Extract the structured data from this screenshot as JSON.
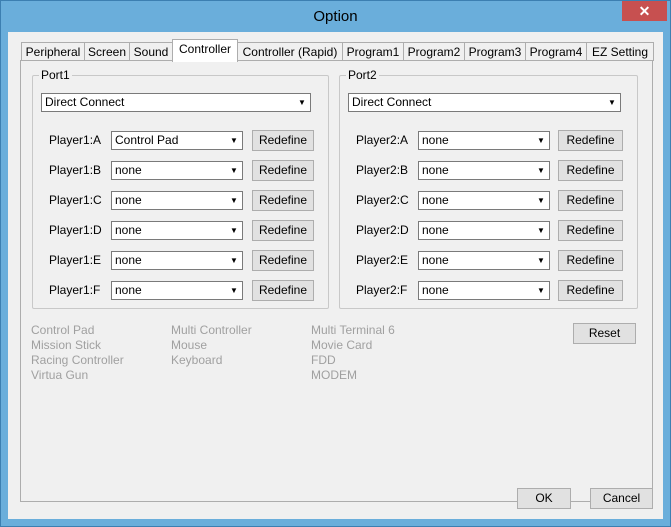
{
  "window": {
    "title": "Option",
    "close_label": "✕"
  },
  "tabs": [
    {
      "label": "Peripheral",
      "active": false
    },
    {
      "label": "Screen",
      "active": false
    },
    {
      "label": "Sound",
      "active": false
    },
    {
      "label": "Controller",
      "active": true
    },
    {
      "label": "Controller (Rapid)",
      "active": false
    },
    {
      "label": "Program1",
      "active": false
    },
    {
      "label": "Program2",
      "active": false
    },
    {
      "label": "Program3",
      "active": false
    },
    {
      "label": "Program4",
      "active": false
    },
    {
      "label": "EZ Setting",
      "active": false
    }
  ],
  "port1": {
    "label": "Port1",
    "connection": "Direct Connect",
    "players": [
      {
        "label": "Player1:A",
        "value": "Control Pad",
        "button": "Redefine"
      },
      {
        "label": "Player1:B",
        "value": "none",
        "button": "Redefine"
      },
      {
        "label": "Player1:C",
        "value": "none",
        "button": "Redefine"
      },
      {
        "label": "Player1:D",
        "value": "none",
        "button": "Redefine"
      },
      {
        "label": "Player1:E",
        "value": "none",
        "button": "Redefine"
      },
      {
        "label": "Player1:F",
        "value": "none",
        "button": "Redefine"
      }
    ]
  },
  "port2": {
    "label": "Port2",
    "connection": "Direct Connect",
    "players": [
      {
        "label": "Player2:A",
        "value": "none",
        "button": "Redefine"
      },
      {
        "label": "Player2:B",
        "value": "none",
        "button": "Redefine"
      },
      {
        "label": "Player2:C",
        "value": "none",
        "button": "Redefine"
      },
      {
        "label": "Player2:D",
        "value": "none",
        "button": "Redefine"
      },
      {
        "label": "Player2:E",
        "value": "none",
        "button": "Redefine"
      },
      {
        "label": "Player2:F",
        "value": "none",
        "button": "Redefine"
      }
    ]
  },
  "devices": {
    "col1": [
      "Control Pad",
      "Mission Stick",
      "Racing Controller",
      "Virtua Gun"
    ],
    "col2": [
      "Multi Controller",
      "Mouse",
      "Keyboard"
    ],
    "col3": [
      "Multi Terminal 6",
      "Movie Card",
      "FDD",
      "MODEM"
    ]
  },
  "reset_label": "Reset",
  "ok_label": "OK",
  "cancel_label": "Cancel",
  "colors": {
    "titlebar": "#6aaedb",
    "close": "#c75050",
    "disabled_text": "#a0a0a0"
  }
}
